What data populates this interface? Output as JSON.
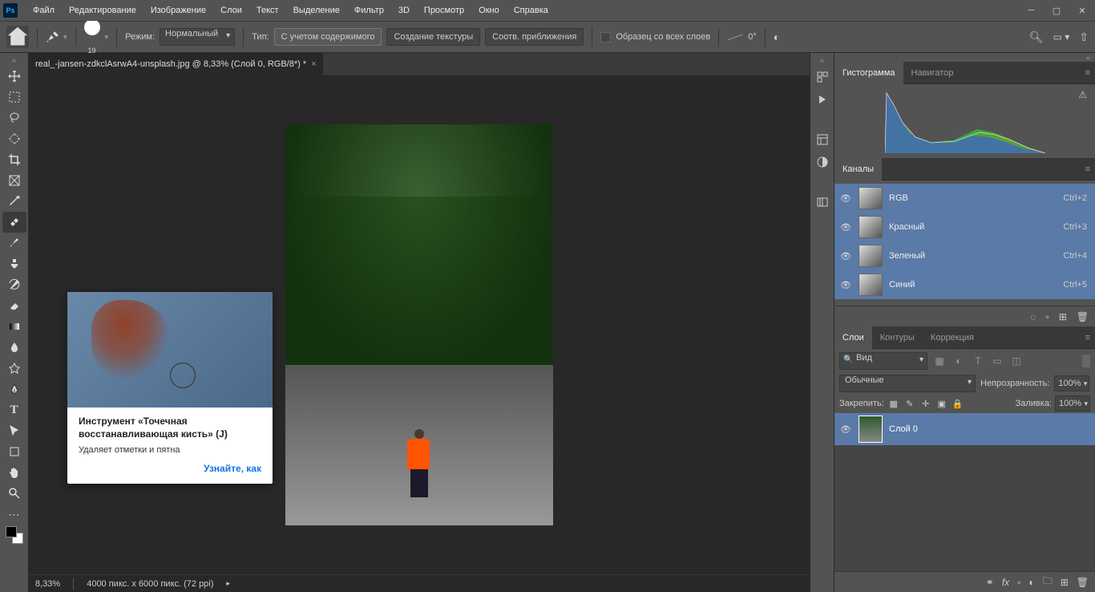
{
  "menu": [
    "Файл",
    "Редактирование",
    "Изображение",
    "Слои",
    "Текст",
    "Выделение",
    "Фильтр",
    "3D",
    "Просмотр",
    "Окно",
    "Справка"
  ],
  "optbar": {
    "brush_size": "19",
    "mode_label": "Режим:",
    "mode_value": "Нормальный",
    "type_label": "Тип:",
    "btn1": "С учетом содержимого",
    "btn2": "Создание текстуры",
    "btn3": "Соотв. приближения",
    "sample_all": "Образец со всех слоев",
    "angle": "0°"
  },
  "doc": {
    "tab": "real_-jansen-zdkclAsrwA4-unsplash.jpg @ 8,33% (Слой 0, RGB/8*) *"
  },
  "tooltip": {
    "title": "Инструмент «Точечная восстанавливающая кисть» (J)",
    "desc": "Удаляет отметки и пятна",
    "link": "Узнайте, как"
  },
  "status": {
    "zoom": "8,33%",
    "dims": "4000 пикс. x 6000 пикс. (72 ppi)"
  },
  "panels": {
    "histogram": {
      "tab1": "Гистограмма",
      "tab2": "Навигатор"
    },
    "channels": {
      "tab": "Каналы",
      "items": [
        {
          "name": "RGB",
          "short": "Ctrl+2"
        },
        {
          "name": "Красный",
          "short": "Ctrl+3"
        },
        {
          "name": "Зеленый",
          "short": "Ctrl+4"
        },
        {
          "name": "Синий",
          "short": "Ctrl+5"
        }
      ]
    },
    "layers": {
      "tab1": "Слои",
      "tab2": "Контуры",
      "tab3": "Коррекция",
      "filter": "Вид",
      "blend": "Обычные",
      "opacity_label": "Непрозрачность:",
      "opacity": "100%",
      "lock_label": "Закрепить:",
      "fill_label": "Заливка:",
      "fill": "100%",
      "layer0": "Слой 0"
    }
  }
}
